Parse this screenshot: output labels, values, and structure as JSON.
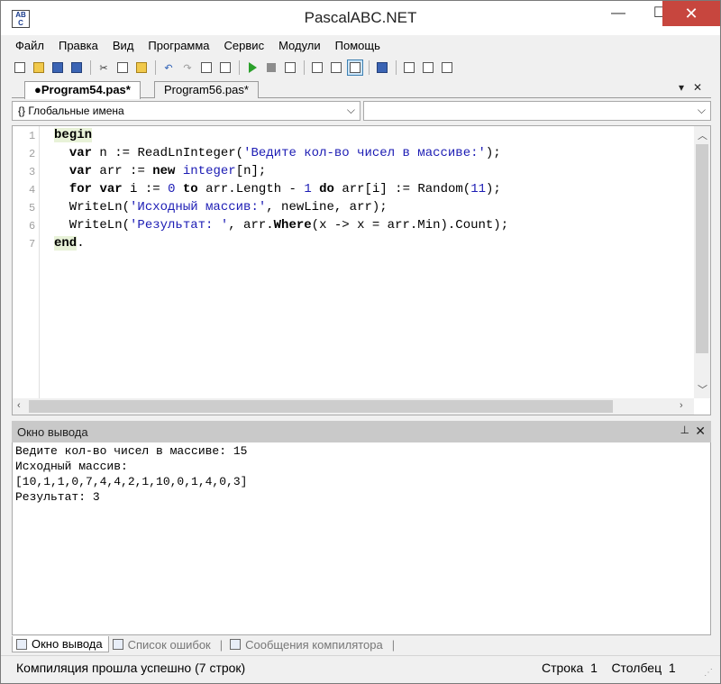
{
  "window": {
    "title": "PascalABC.NET",
    "icon_text_top": "AB",
    "icon_text_bottom": "C",
    "minimize": "—",
    "maximize": "☐",
    "close": "✕"
  },
  "menu": [
    "Файл",
    "Правка",
    "Вид",
    "Программа",
    "Сервис",
    "Модули",
    "Помощь"
  ],
  "tabs": {
    "active": "●Program54.pas*",
    "inactive": "Program56.pas*",
    "dropdown": "▾",
    "close": "✕"
  },
  "combos": {
    "left": "{} Глобальные имена",
    "right": ""
  },
  "editor": {
    "line_numbers": [
      "1",
      "2",
      "3",
      "4",
      "5",
      "6",
      "7"
    ],
    "lines": [
      [
        {
          "t": "begin",
          "c": "kw hl"
        }
      ],
      [
        {
          "t": "  "
        },
        {
          "t": "var",
          "c": "kw"
        },
        {
          "t": " n := ReadLnInteger("
        },
        {
          "t": "'Ведите кол-во чисел в массиве:'",
          "c": "str"
        },
        {
          "t": ");"
        }
      ],
      [
        {
          "t": "  "
        },
        {
          "t": "var",
          "c": "kw"
        },
        {
          "t": " arr := "
        },
        {
          "t": "new",
          "c": "kw"
        },
        {
          "t": " "
        },
        {
          "t": "integer",
          "c": "typ"
        },
        {
          "t": "[n];"
        }
      ],
      [
        {
          "t": "  "
        },
        {
          "t": "for",
          "c": "kw"
        },
        {
          "t": " "
        },
        {
          "t": "var",
          "c": "kw"
        },
        {
          "t": " i := "
        },
        {
          "t": "0",
          "c": "num"
        },
        {
          "t": " "
        },
        {
          "t": "to",
          "c": "kw"
        },
        {
          "t": " arr.Length - "
        },
        {
          "t": "1",
          "c": "num"
        },
        {
          "t": " "
        },
        {
          "t": "do",
          "c": "kw"
        },
        {
          "t": " arr[i] := Random("
        },
        {
          "t": "11",
          "c": "num"
        },
        {
          "t": ");"
        }
      ],
      [
        {
          "t": "  WriteLn("
        },
        {
          "t": "'Исходный массив:'",
          "c": "str"
        },
        {
          "t": ", newLine, arr);"
        }
      ],
      [
        {
          "t": "  WriteLn("
        },
        {
          "t": "'Результат: '",
          "c": "str"
        },
        {
          "t": ", arr."
        },
        {
          "t": "Where",
          "c": "kw"
        },
        {
          "t": "(x -> x = arr.Min).Count);"
        }
      ],
      [
        {
          "t": "end",
          "c": "kw hl"
        },
        {
          "t": "."
        }
      ]
    ]
  },
  "output": {
    "header": "Окно вывода",
    "pin": "📌",
    "close": "✕",
    "lines": [
      "Ведите кол-во чисел в массиве: 15",
      "Исходный массив:",
      "[10,1,1,0,7,4,4,2,1,10,0,1,4,0,3]",
      "Результат: 3"
    ]
  },
  "bottom_tabs": [
    "Окно вывода",
    "Список ошибок",
    "Сообщения компилятора"
  ],
  "status": {
    "message": "Компиляция прошла успешно (7 строк)",
    "position": "Строка  1    Столбец  1"
  }
}
